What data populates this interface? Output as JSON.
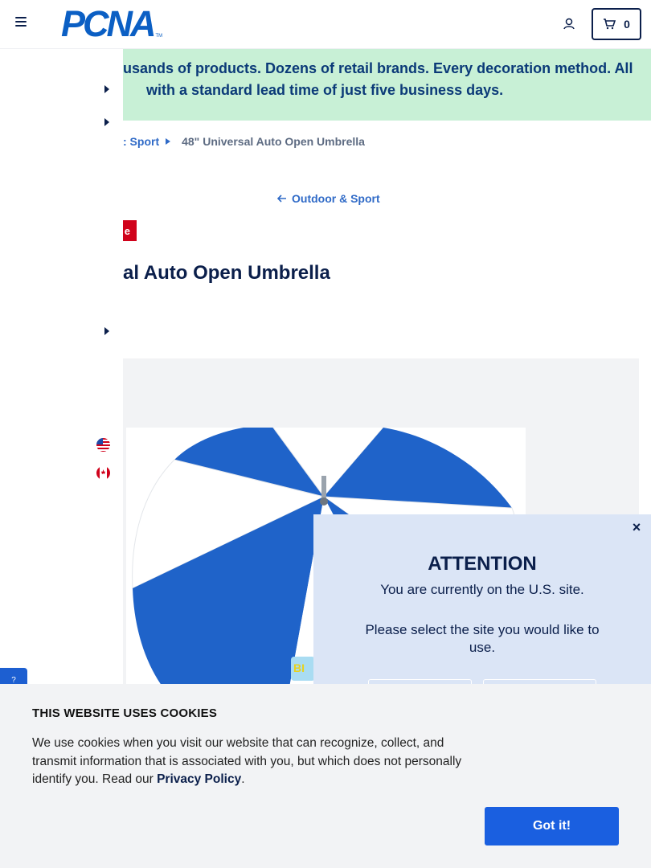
{
  "header": {
    "logo_text": "PCNA",
    "logo_tm": "TM",
    "cart_count": "0"
  },
  "banner": {
    "line1": "usands of products. Dozens of retail brands. Every decoration method. All",
    "line2": "with a standard lead time of just five business days."
  },
  "breadcrumb": {
    "parent": ": Sport",
    "current": "48\" Universal Auto Open Umbrella"
  },
  "back_link": "Outdoor & Sport",
  "sale_badge": "e",
  "product_title": "al Auto Open Umbrella",
  "side_tab": "?",
  "modal": {
    "close": "×",
    "title": "ATTENTION",
    "subtitle": "You are currently on the U.S. site.",
    "question": "Please select the site you would like to use."
  },
  "cookie": {
    "title": "THIS WEBSITE USES COOKIES",
    "text": "We use cookies when you visit our website that can recognize, collect, and transmit information that is associated with you, but which does not personally identify you. Read our ",
    "link": "Privacy Policy",
    "period": ".",
    "button": "Got it!"
  },
  "colors": {
    "brand": "#0b5fc4",
    "navy": "#0b1f4b",
    "banner_bg": "#c8f0d6",
    "umbrella_blue": "#1f63c9",
    "button_blue": "#1a5fe0"
  }
}
